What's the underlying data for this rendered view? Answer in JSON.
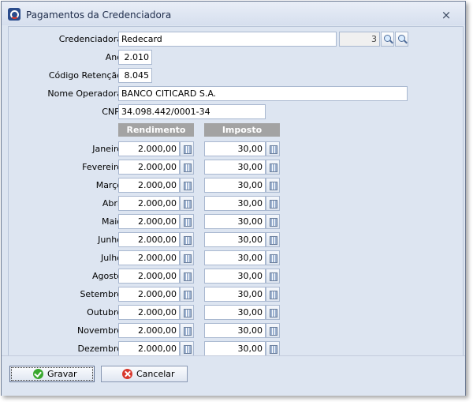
{
  "window": {
    "title": "Pagamentos da Credenciadora",
    "close_label": "×"
  },
  "form": {
    "credenciadora": {
      "label": "Credenciadora",
      "value": "Redecard",
      "code": "3"
    },
    "ano": {
      "label": "Ano",
      "value": "2.010"
    },
    "codigo_retencao": {
      "label": "Código Retenção",
      "value": "8.045"
    },
    "nome_operadora": {
      "label": "Nome Operadora",
      "value": "BANCO CITICARD S.A."
    },
    "cnpj": {
      "label": "CNPJ",
      "value": "34.098.442/0001-34"
    }
  },
  "table": {
    "headers": {
      "rendimento": "Rendimento",
      "imposto": "Imposto"
    },
    "rows": [
      {
        "month": "Janeiro",
        "rendimento": "2.000,00",
        "imposto": "30,00"
      },
      {
        "month": "Fevereiro",
        "rendimento": "2.000,00",
        "imposto": "30,00"
      },
      {
        "month": "Março",
        "rendimento": "2.000,00",
        "imposto": "30,00"
      },
      {
        "month": "Abril",
        "rendimento": "2.000,00",
        "imposto": "30,00"
      },
      {
        "month": "Maio",
        "rendimento": "2.000,00",
        "imposto": "30,00"
      },
      {
        "month": "Junho",
        "rendimento": "2.000,00",
        "imposto": "30,00"
      },
      {
        "month": "Julho",
        "rendimento": "2.000,00",
        "imposto": "30,00"
      },
      {
        "month": "Agosto",
        "rendimento": "2.000,00",
        "imposto": "30,00"
      },
      {
        "month": "Setembro",
        "rendimento": "2.000,00",
        "imposto": "30,00"
      },
      {
        "month": "Outubro",
        "rendimento": "2.000,00",
        "imposto": "30,00"
      },
      {
        "month": "Novembro",
        "rendimento": "2.000,00",
        "imposto": "30,00"
      },
      {
        "month": "Dezembro",
        "rendimento": "2.000,00",
        "imposto": "30,00"
      }
    ]
  },
  "buttons": {
    "save": "Gravar",
    "cancel": "Cancelar"
  },
  "icons": {
    "app": "app-logo-icon",
    "search": "magnifier-icon",
    "calc": "calculator-icon",
    "ok": "check-icon",
    "cancel": "cancel-icon"
  }
}
